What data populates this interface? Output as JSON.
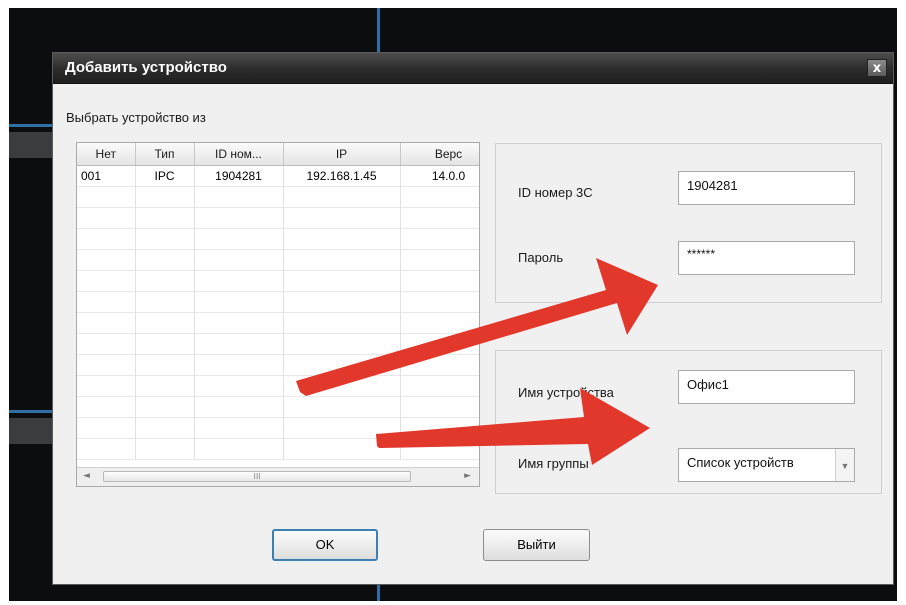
{
  "dialog": {
    "title": "Добавить устройство",
    "close_label": "x",
    "select_from_label": "Выбрать устройство из"
  },
  "device_table": {
    "columns": [
      "Нет",
      "Тип",
      "ID ном...",
      "IP",
      "Верс"
    ],
    "rows": [
      [
        "001",
        "IPC",
        "1904281",
        "192.168.1.45",
        "14.0.0"
      ]
    ],
    "scroll_thumb_grip": "III"
  },
  "login_group": {
    "id_label": "ID номер 3C",
    "id_value": "1904281",
    "password_label": "Пароль",
    "password_value": "******"
  },
  "device_group": {
    "name_label": "Имя устройства",
    "name_value": "Офис1",
    "group_label": "Имя группы",
    "group_value": "Список устройств"
  },
  "buttons": {
    "ok": "OK",
    "exit": "Выйти"
  },
  "icons": {
    "close": "close-icon",
    "dropdown": "chevron-down-icon",
    "scroll_left": "scroll-left-icon",
    "scroll_right": "scroll-right-icon"
  },
  "colors": {
    "annotation_arrow": "#e2372b",
    "titlebar": "#2b2b2b",
    "focus_border": "#3c7fb1"
  }
}
